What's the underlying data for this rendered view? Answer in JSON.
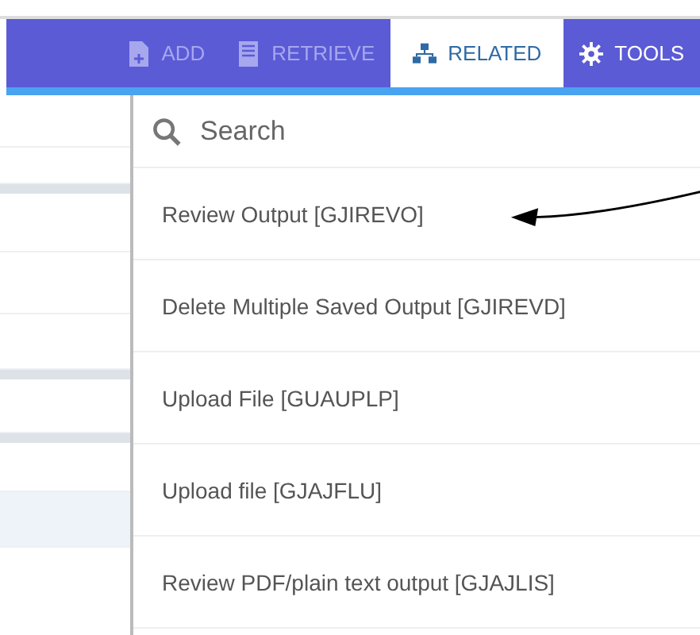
{
  "tabs": [
    {
      "label": "ADD",
      "kind": "add",
      "selected": false,
      "disabled": true
    },
    {
      "label": "RETRIEVE",
      "kind": "retrieve",
      "selected": false,
      "disabled": true
    },
    {
      "label": "RELATED",
      "kind": "related",
      "selected": true,
      "disabled": false
    },
    {
      "label": "TOOLS",
      "kind": "tools",
      "selected": false,
      "disabled": false
    }
  ],
  "search": {
    "placeholder": "Search"
  },
  "menu_items": [
    {
      "label": "Review Output [GJIREVO]",
      "pointed": true
    },
    {
      "label": "Delete Multiple Saved Output [GJIREVD]",
      "pointed": false
    },
    {
      "label": "Upload File [GUAUPLP]",
      "pointed": false
    },
    {
      "label": "Upload file [GJAJFLU]",
      "pointed": false
    },
    {
      "label": "Review PDF/plain text output [GJAJLIS]",
      "pointed": false
    }
  ]
}
